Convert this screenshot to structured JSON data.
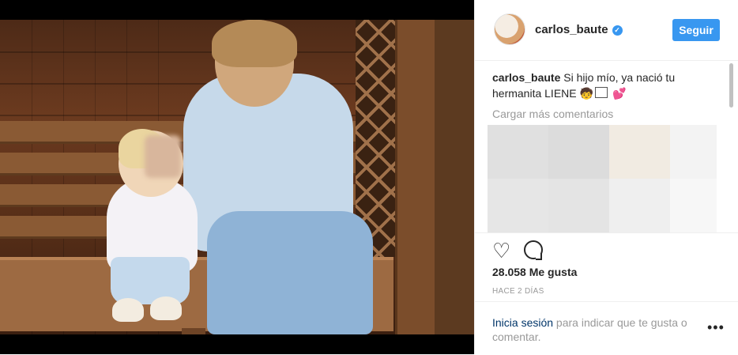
{
  "post": {
    "username": "carlos_baute",
    "follow_label": "Seguir",
    "caption_author": "carlos_baute",
    "caption_text": " Si hijo mío, ya nació tu hermanita LIENE ",
    "load_more": "Cargar más comentarios",
    "likes": "28.058 Me gusta",
    "time": "HACE 2 DÍAS"
  },
  "icons": {
    "verified": "verified-badge-icon",
    "like": "heart-icon",
    "comment": "comment-icon",
    "more": "more-options-icon"
  },
  "login": {
    "link": "Inicia sesión",
    "text": " para indicar que te gusta o comentar."
  },
  "colors": {
    "accent": "#3897f0",
    "link": "#003569",
    "muted": "#999999"
  }
}
